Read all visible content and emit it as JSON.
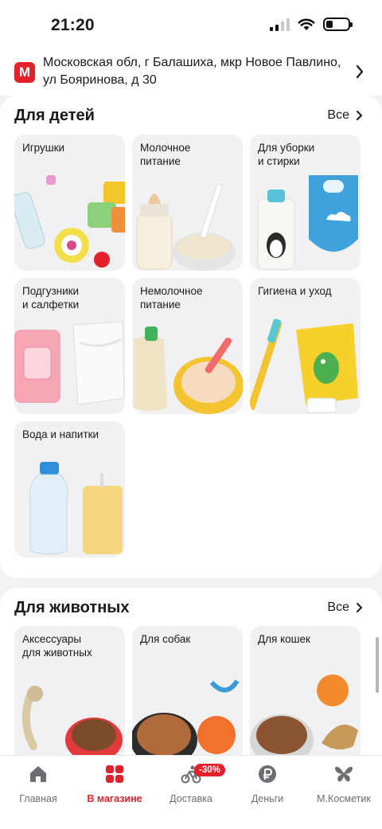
{
  "status_bar": {
    "time": "21:20",
    "battery_level": 0.3
  },
  "address": {
    "logo_letter": "М",
    "text": "Московская обл, г Балашиха, мкр Новое Павлино, ул Бояринова, д 30"
  },
  "kids": {
    "title": "Для детей",
    "all_label": "Все",
    "tiles": [
      {
        "label": "Игрушки"
      },
      {
        "label": "Молочное\nпитание"
      },
      {
        "label": "Для уборки\nи стирки"
      },
      {
        "label": "Подгузники\nи салфетки"
      },
      {
        "label": "Немолочное\nпитание"
      },
      {
        "label": "Гигиена и уход"
      },
      {
        "label": "Вода и напитки"
      }
    ]
  },
  "pets": {
    "title": "Для животных",
    "all_label": "Все",
    "tiles": [
      {
        "label": "Аксессуары\nдля животных"
      },
      {
        "label": "Для собак"
      },
      {
        "label": "Для кошек"
      }
    ]
  },
  "tabbar": {
    "items": [
      {
        "label": "Главная",
        "icon": "home-icon"
      },
      {
        "label": "В магазине",
        "icon": "store-grid-icon",
        "active": true
      },
      {
        "label": "Доставка",
        "icon": "courier-bike-icon",
        "badge": "-30%"
      },
      {
        "label": "Деньги",
        "icon": "ruble-icon"
      },
      {
        "label": "М.Косметик",
        "icon": "butterfly-icon"
      }
    ]
  },
  "colors": {
    "accent": "#e4202a",
    "tile_bg": "#f1f1f3"
  }
}
